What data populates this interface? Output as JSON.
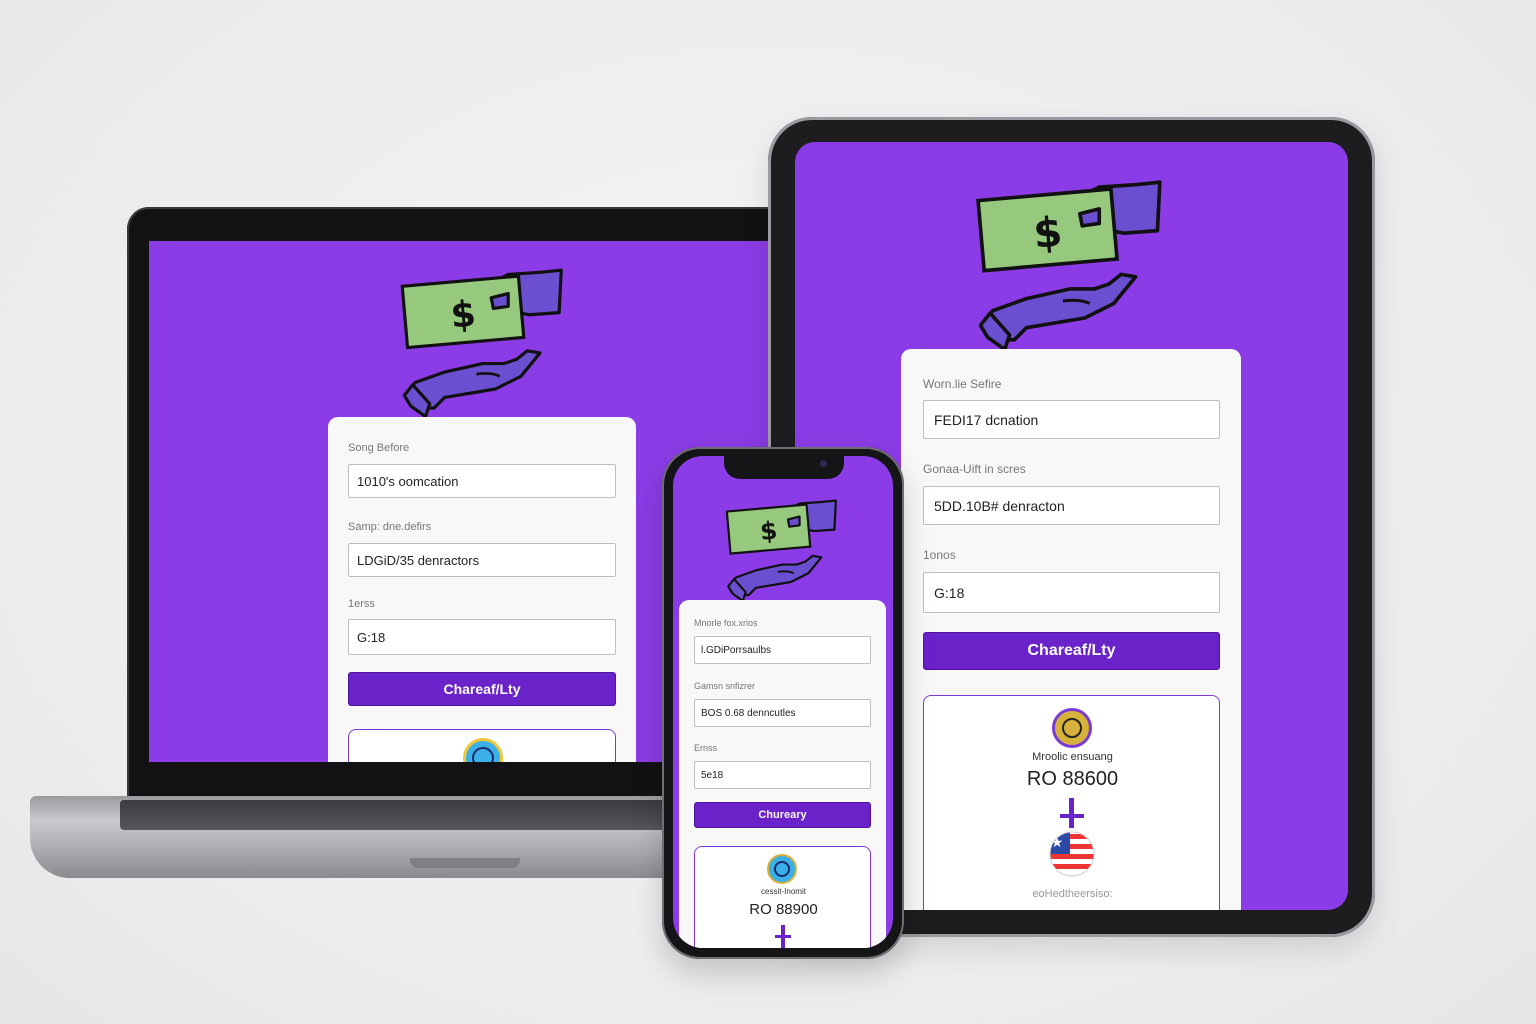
{
  "colors": {
    "screen_bg": "#8b3ce6",
    "accent_button": "#6a22c9",
    "card_bg": "#f8f8f9",
    "money_green": "#96c97e",
    "hand_purple": "#6a4fd0"
  },
  "laptop": {
    "label_1": "Song Before",
    "field_1": "1010's oomcation",
    "label_2": "Samp: dne.defirs",
    "field_2": "LDGiD/35 denractors",
    "label_3": "1erss",
    "field_3": "G:18",
    "button": "Chareaf/Lty"
  },
  "tablet": {
    "label_1": "Worn.lie Sefire",
    "field_1": "FEDI17 dcnation",
    "label_2": "Gonaa-Uift in scres",
    "field_2": "5DD.10B# denracton",
    "label_3": "1onos",
    "field_3": "G:18",
    "button": "Chareaf/Lty",
    "summary_caption": "Mroolic ensuang",
    "summary_amount": "RO 88600",
    "summary_footer": "eoHedtheersiso:"
  },
  "phone": {
    "label_1": "Mnorle fox.xrios",
    "field_1": "l.GDiPorrsaulbs",
    "label_2": "Gamsn snfizrer",
    "field_2": "BOS 0.68 denncutles",
    "label_3": "Ernss",
    "field_3": "5e18",
    "button": "Chureary",
    "summary_caption": "cessit-Inomit",
    "summary_amount": "RO 88900"
  },
  "icons": {
    "illustration": "money-hand-icon",
    "coin": "coin-logo-icon",
    "flag": "us-flag-icon"
  }
}
